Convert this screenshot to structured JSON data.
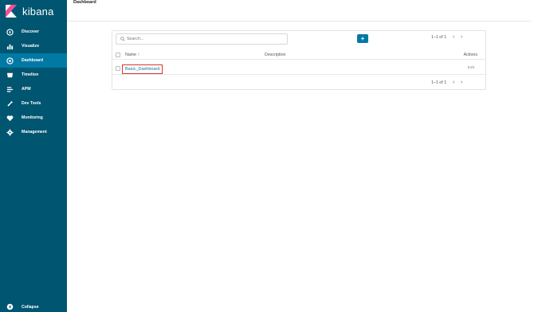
{
  "sidebar": {
    "brand": "kibana",
    "items": [
      {
        "label": "Discover",
        "icon": "compass-icon"
      },
      {
        "label": "Visualize",
        "icon": "bar-chart-icon"
      },
      {
        "label": "Dashboard",
        "icon": "dashboard-icon",
        "active": true
      },
      {
        "label": "Timelion",
        "icon": "timelion-icon"
      },
      {
        "label": "APM",
        "icon": "apm-icon"
      },
      {
        "label": "Dev Tools",
        "icon": "wrench-icon"
      },
      {
        "label": "Monitoring",
        "icon": "heartbeat-icon"
      },
      {
        "label": "Management",
        "icon": "gear-icon"
      }
    ],
    "collapse_label": "Collapse"
  },
  "header": {
    "title": "Dashboard"
  },
  "main": {
    "search_placeholder": "Search...",
    "add_label": "+",
    "pagination": "1–1 of 1",
    "columns": {
      "name": "Name ↑",
      "description": "Description",
      "actions": "Actions"
    },
    "rows": [
      {
        "name": "Basic_Dashboard",
        "description": "",
        "action": "Edit"
      }
    ]
  },
  "colors": {
    "sidebar_bg": "#005571",
    "active_bg": "#0079a5",
    "accent": "#0079a5",
    "highlight": "#d9372b"
  }
}
